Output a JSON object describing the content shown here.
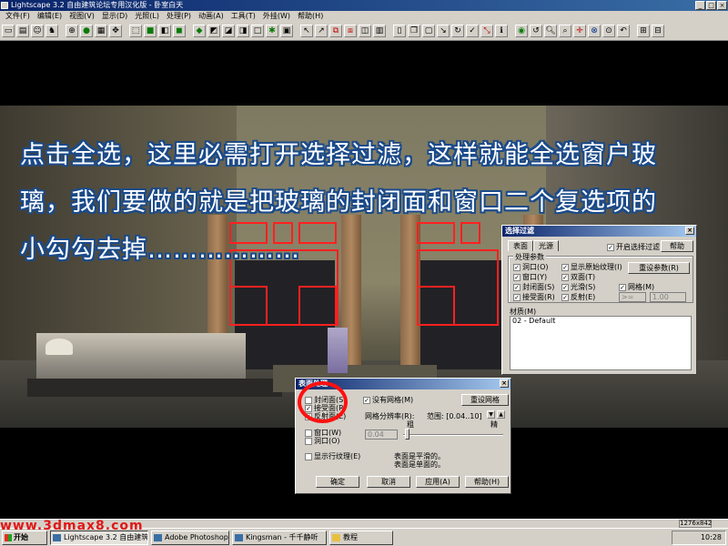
{
  "window": {
    "title": "Lightscape 3.2 自由建筑论坛专用汉化版 - 卧室白天"
  },
  "menu": [
    "文件(F)",
    "编辑(E)",
    "视图(V)",
    "显示(D)",
    "光照(L)",
    "处理(P)",
    "动画(A)",
    "工具(T)",
    "外挂(W)",
    "帮助(H)"
  ],
  "hint": {
    "line1": "点击全选，这里必需打开选择过滤，这样就能全选窗户玻",
    "line2": "璃，我们要做的就是把玻璃的封闭面和窗口二个复选项的",
    "line3": "小勾勾去掉………………"
  },
  "filter_dialog": {
    "title": "选择过滤",
    "tabs": [
      "表面",
      "光源"
    ],
    "enable_label": "开启选择过滤",
    "enable_checked": true,
    "help_label": "帮助",
    "group_label": "处理参数",
    "options": [
      {
        "label": "洞口(O)",
        "checked": true
      },
      {
        "label": "显示原始纹理(I)",
        "checked": true
      },
      {
        "label": "窗口(Y)",
        "checked": true
      },
      {
        "label": "双面(T)",
        "checked": true
      },
      {
        "label": "封闭面(S)",
        "checked": true
      },
      {
        "label": "光滑(S)",
        "checked": true
      },
      {
        "label": "接受面(R)",
        "checked": true
      },
      {
        "label": "反射(E)",
        "checked": true
      },
      {
        "label": "网格(M)",
        "checked": true
      }
    ],
    "reset_label": "重设参数(R)",
    "op_value": ">=",
    "mesh_value": "1.00",
    "material_label": "材质(M)",
    "material_value": "02 - Default"
  },
  "surface_dialog": {
    "title": "表面处理",
    "checks": [
      {
        "label": "封闭面(S)",
        "checked": false
      },
      {
        "label": "接受面(R)",
        "checked": true
      },
      {
        "label": "反射面(E)",
        "checked": true
      },
      {
        "label": "窗口(W)",
        "checked": false
      },
      {
        "label": "洞口(O)",
        "checked": false
      }
    ],
    "no_mesh_label": "没有网格(M)",
    "no_mesh_checked": true,
    "reset_mesh_label": "重设网格",
    "mesh_res_label": "网格分辨率(R):",
    "range_label": "范围: [0.04..10]",
    "coarse_label": "粗",
    "fine_label": "精",
    "res_value": "0.04",
    "show_texture_label": "显示行纹理(E)",
    "smooth_note": "表面是平滑的。",
    "single_note": "表面是单面的。",
    "ok_label": "确定",
    "cancel_label": "取消",
    "apply_label": "应用(A)",
    "help_label": "帮助(H)"
  },
  "taskbar": {
    "start_label": "开始",
    "tasks": [
      "Lightscape 3.2 自由建筑...",
      "Adobe Photoshop",
      "Kingsman - 千千静听",
      "教程"
    ],
    "clock": "10:28"
  },
  "statusbar": {
    "resolution": "1276x842"
  },
  "watermark": "www.3dmax8.com"
}
